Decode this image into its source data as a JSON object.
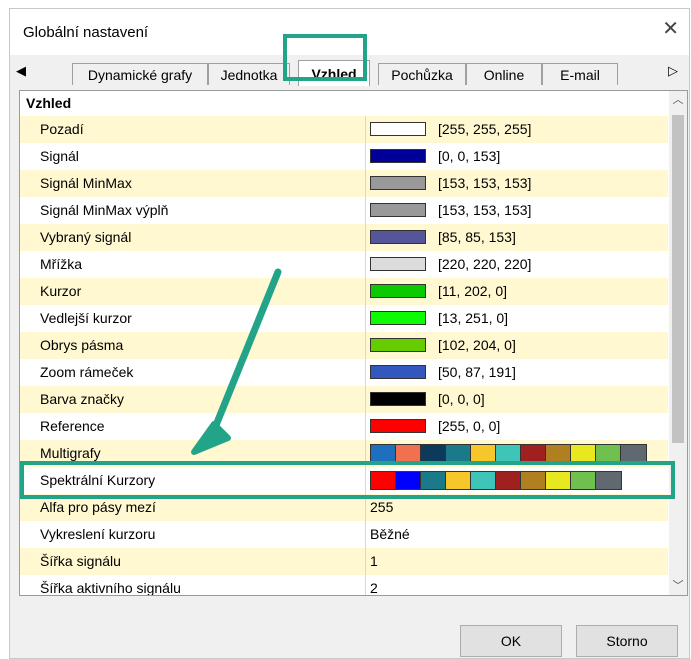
{
  "dialog": {
    "title": "Globální nastavení"
  },
  "tabs": [
    {
      "label": "Dynamické grafy"
    },
    {
      "label": "Jednotka"
    },
    {
      "label": "Vzhled",
      "active": true
    },
    {
      "label": "Pochůzka"
    },
    {
      "label": "Online"
    },
    {
      "label": "E-mail"
    }
  ],
  "section": {
    "title": "Vzhled"
  },
  "rows": [
    {
      "label": "Pozadí",
      "color": "#ffffff",
      "value": "[255, 255, 255]"
    },
    {
      "label": "Signál",
      "color": "#000099",
      "value": "[0, 0, 153]"
    },
    {
      "label": "Signál MinMax",
      "color": "#999999",
      "value": "[153, 153, 153]"
    },
    {
      "label": "Signál MinMax výplň",
      "color": "#999999",
      "value": "[153, 153, 153]"
    },
    {
      "label": "Vybraný signál",
      "color": "#555599",
      "value": "[85, 85, 153]"
    },
    {
      "label": "Mřížka",
      "color": "#dcdcdc",
      "value": "[220, 220, 220]"
    },
    {
      "label": "Kurzor",
      "color": "#0bca00",
      "value": "[11, 202, 0]"
    },
    {
      "label": "Vedlejší kurzor",
      "color": "#0dfb00",
      "value": "[13, 251, 0]"
    },
    {
      "label": "Obrys pásma",
      "color": "#66cc00",
      "value": "[102, 204, 0]"
    },
    {
      "label": "Zoom rámeček",
      "color": "#3257bf",
      "value": "[50, 87, 191]"
    },
    {
      "label": "Barva značky",
      "color": "#000000",
      "value": "[0, 0, 0]"
    },
    {
      "label": "Reference",
      "color": "#ff0000",
      "value": "[255, 0, 0]"
    }
  ],
  "multi_rows": [
    {
      "label": "Multigrafy",
      "colors": [
        "#1f6fbf",
        "#f07050",
        "#0d3a5a",
        "#1a7a8a",
        "#f5c72a",
        "#3fc4b8",
        "#a02020",
        "#b08020",
        "#e8e820",
        "#70c050",
        "#606870"
      ]
    },
    {
      "label": "Spektrální Kurzory",
      "colors": [
        "#ff0000",
        "#0000ff",
        "#1a7a8a",
        "#f5c72a",
        "#3fc4b8",
        "#a02020",
        "#b08020",
        "#e8e820",
        "#70c050",
        "#606870"
      ]
    }
  ],
  "text_rows": [
    {
      "label": "Alfa pro pásy mezí",
      "value": "255"
    },
    {
      "label": "Vykreslení kurzoru",
      "value": "Běžné"
    },
    {
      "label": "Šířka signálu",
      "value": "1"
    },
    {
      "label": "Šířka aktivního signálu",
      "value": "2"
    }
  ],
  "buttons": {
    "ok": "OK",
    "cancel": "Storno"
  },
  "annotation_color": "#23a488"
}
